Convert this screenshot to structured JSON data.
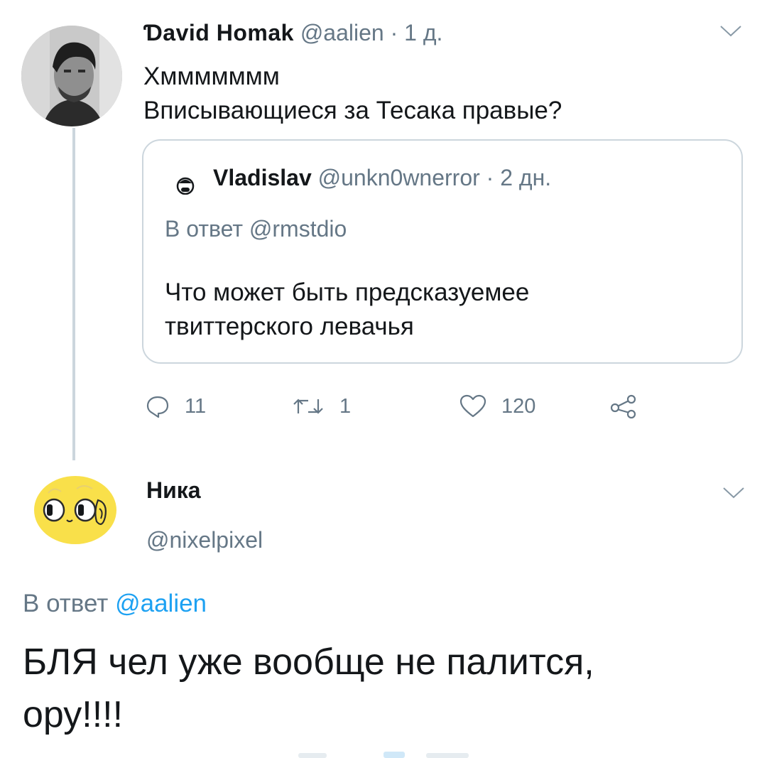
{
  "tweet1": {
    "author_name": "Ɗavid Homak",
    "handle": "@aalien",
    "time": "1 д.",
    "text_line1": "Хммммммм",
    "text_line2": "Вписывающиеся за Тесака правые?",
    "quoted": {
      "author_name": "Vladislav",
      "handle": "@unkn0wnerror",
      "time": "2 дн.",
      "reply_prefix": "В ответ",
      "reply_to": "@rmstdio",
      "text_line1": "Что может быть предсказуемее",
      "text_line2": "твиттерского левачья"
    },
    "actions": {
      "replies": "11",
      "retweets": "1",
      "likes": "120"
    }
  },
  "tweet2": {
    "author_name": "Ника",
    "handle": "@nixelpixel",
    "reply_prefix": "В ответ",
    "reply_to": "@aalien",
    "text_line1": "БЛЯ чел уже вообще не палится,",
    "text_line2": "ору!!!!"
  },
  "colors": {
    "muted": "#657786",
    "link": "#1da1f2",
    "border": "#ccd6dd",
    "text": "#14171a"
  },
  "icons": [
    "chevron-down-icon",
    "reply-icon",
    "retweet-icon",
    "like-icon",
    "share-icon"
  ]
}
